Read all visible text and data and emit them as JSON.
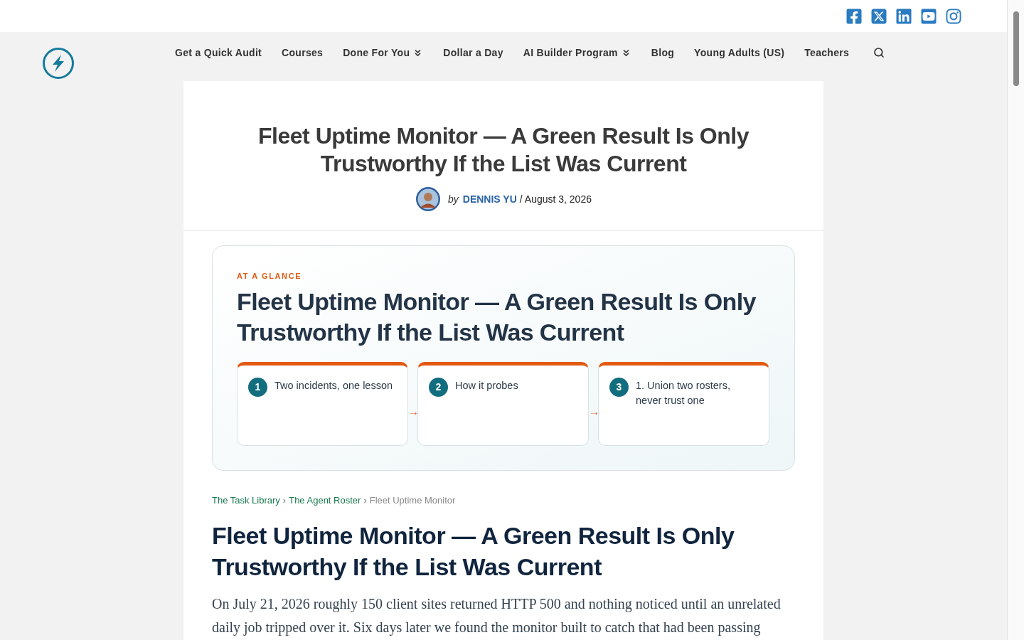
{
  "nav": {
    "items": [
      {
        "label": "Get a Quick Audit",
        "dropdown": false
      },
      {
        "label": "Courses",
        "dropdown": false
      },
      {
        "label": "Done For You",
        "dropdown": true
      },
      {
        "label": "Dollar a Day",
        "dropdown": false
      },
      {
        "label": "AI Builder Program",
        "dropdown": true
      },
      {
        "label": "Blog",
        "dropdown": false
      },
      {
        "label": "Young Adults (US)",
        "dropdown": false
      },
      {
        "label": "Teachers",
        "dropdown": false
      }
    ]
  },
  "header": {
    "title": "Fleet Uptime Monitor — A Green Result Is Only Trustworthy If the List Was Current",
    "by": "by",
    "author": "DENNIS YU",
    "date": "/ August 3, 2026"
  },
  "glance": {
    "eyebrow": "AT A GLANCE",
    "title": "Fleet Uptime Monitor — A Green Result Is Only Trustworthy If the List Was Current",
    "arrow": "→",
    "steps": [
      {
        "number": "1",
        "label": "Two incidents, one lesson"
      },
      {
        "number": "2",
        "label": "How it probes"
      },
      {
        "number": "3",
        "label": "1. Union two rosters, never trust one"
      }
    ]
  },
  "breadcrumb": [
    {
      "label": "The Task Library",
      "link": true
    },
    {
      "label": "The Agent Roster",
      "link": true
    },
    {
      "label": "Fleet Uptime Monitor",
      "link": false
    }
  ],
  "separator": "›",
  "article": {
    "title": "Fleet Uptime Monitor — A Green Result Is Only Trustworthy If the List Was Current",
    "paragraph": "On July 21, 2026 roughly 150 client sites returned HTTP 500 and nothing noticed until an unrelated daily job tripped over it. Six days later we found the monitor built to catch that had been passing"
  }
}
